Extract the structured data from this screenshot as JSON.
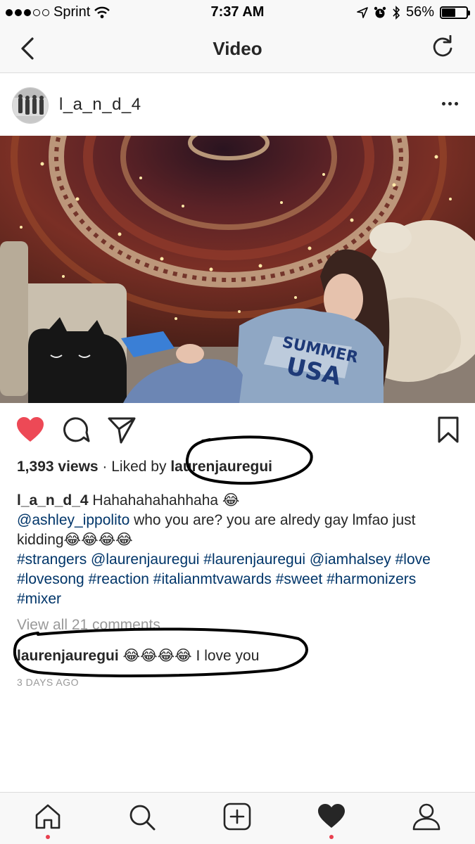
{
  "status_bar": {
    "carrier": "Sprint",
    "time": "7:37 AM",
    "battery_text": "56%",
    "battery_level": 0.56
  },
  "nav": {
    "title": "Video"
  },
  "post": {
    "username": "l_a_n_d_4",
    "views_count": "1,393 views",
    "liked_by_prefix": " · Liked by ",
    "liked_by_user": "laurenjauregui",
    "caption_user": "l_a_n_d_4",
    "caption_text": " Hahahahahahhaha 😂",
    "mention": "@ashley_ippolito",
    "caption_line2": " who you are? you are alredy gay lmfao just kidding😂😂😂😂",
    "hashtags": "#strangers @laurenjauregui #laurenjauregui @iamhalsey #love #lovesong #reaction #italianmtvawards #sweet #harmonizers #mixer",
    "view_all_comments": "View all 21 comments",
    "comment_user": "laurenjauregui",
    "comment_text": " 😂😂😂😂  I love you",
    "timestamp": "3 DAYS AGO"
  },
  "icons": {
    "back": "chevron-left-icon",
    "refresh": "refresh-icon",
    "more": "more-icon",
    "like": "heart-icon",
    "comment": "comment-icon",
    "share": "send-icon",
    "save": "bookmark-icon",
    "home": "home-icon",
    "search": "search-icon",
    "add": "add-icon",
    "activity": "heart-icon",
    "profile": "profile-icon"
  },
  "colors": {
    "like_red": "#ed4956",
    "link_blue": "#003569",
    "muted_gray": "#999999",
    "notification_dot": "#e8404f"
  }
}
